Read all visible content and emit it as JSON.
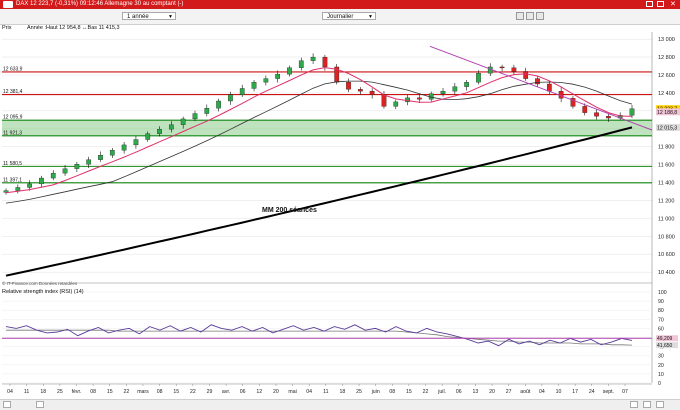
{
  "titlebar": {
    "title": "DAX  12 223,7 (-0,31%)  09:12:46 Allemagne 30 au comptant (-)",
    "color": "#d21a1a"
  },
  "toolbar": {
    "period": "1 année",
    "interval": "Journalier"
  },
  "chart_header": {
    "label": "Prix",
    "stats": "Année :Haut 12 954,8 ↔Bas 11 415,3"
  },
  "copyright": "© IT-Finance.com Données retardées",
  "rsi_header": "Relative strength index (RSI) (14)",
  "chart_data": [
    {
      "type": "candlestick",
      "xlabel": "",
      "ylabel": "",
      "x_ticks": [
        "04",
        "11",
        "18",
        "25",
        "févr.",
        "08",
        "15",
        "22",
        "mars",
        "08",
        "15",
        "22",
        "29",
        "avr.",
        "06",
        "12",
        "20",
        "mai",
        "04",
        "11",
        "18",
        "25",
        "juin",
        "08",
        "15",
        "22",
        "juil.",
        "06",
        "13",
        "20",
        "27",
        "août",
        "04",
        "10",
        "17",
        "24",
        "sept.",
        "07"
      ],
      "y_ticks": [
        10400,
        10600,
        10800,
        11000,
        11200,
        11400,
        11600,
        11800,
        12000,
        12200,
        12400,
        12600,
        12800,
        13000
      ],
      "ylim": [
        10290,
        13080
      ],
      "close_approx": [
        11310,
        11345,
        11385,
        11450,
        11505,
        11555,
        11605,
        11655,
        11705,
        11760,
        11820,
        11880,
        11945,
        11995,
        12045,
        12110,
        12170,
        12230,
        12310,
        12380,
        12450,
        12520,
        12560,
        12610,
        12680,
        12760,
        12800,
        12690,
        12520,
        12440,
        12420,
        12380,
        12250,
        12300,
        12345,
        12330,
        12390,
        12420,
        12470,
        12520,
        12620,
        12690,
        12680,
        12640,
        12560,
        12500,
        12420,
        12340,
        12250,
        12180,
        12140,
        12120,
        12150,
        12223.7
      ],
      "horizontal_levels": [
        {
          "value": 12633.9,
          "label": "12 633,9",
          "color": "#cc1111"
        },
        {
          "value": 12381.4,
          "label": "12 381,4",
          "color": "#cc1111"
        },
        {
          "value": 12095.9,
          "label": "12 095,9",
          "color": "#118811"
        },
        {
          "value": 11921.3,
          "label": "11 921,3",
          "color": "#118811"
        },
        {
          "value": 11580.5,
          "label": "11 580,5",
          "color": "#118811"
        },
        {
          "value": 11397.1,
          "label": "11 397,1",
          "color": "#118811"
        }
      ],
      "support_zone": [
        11921.3,
        12095.9
      ],
      "price_tags": [
        {
          "value": 12223.7,
          "label": "12 223,7",
          "bg": "#ffd200"
        },
        {
          "value": 12188.8,
          "label": "12 188,8",
          "bg": "#f2c4d8"
        },
        {
          "value": 12015.3,
          "label": "12 015,3",
          "bg": "#dddddd"
        }
      ],
      "moving_averages": {
        "mm200": {
          "label": "MM 200 séances",
          "start": 10360,
          "end": 12015,
          "color": "#000000"
        },
        "mm50": {
          "color": "#333333"
        },
        "mm20": {
          "color": "#e0306a"
        }
      },
      "trendline": {
        "from": 12920,
        "to": 12120,
        "color": "#b03fb0"
      }
    },
    {
      "type": "line",
      "name": "Relative strength index (RSI) (14)",
      "y_ticks": [
        0,
        10,
        20,
        30,
        40,
        50,
        60,
        70,
        80,
        90,
        100
      ],
      "ylim": [
        0,
        100
      ],
      "rsi_values": [
        62,
        60,
        63,
        58,
        55,
        56,
        59,
        52,
        57,
        61,
        55,
        58,
        60,
        54,
        62,
        58,
        63,
        57,
        61,
        56,
        64,
        60,
        58,
        62,
        57,
        61,
        55,
        59,
        63,
        58,
        61,
        57,
        62,
        59,
        64,
        58,
        60,
        56,
        62,
        57,
        55,
        60,
        56,
        54,
        51,
        48,
        44,
        46,
        41,
        48,
        43,
        46,
        42,
        47,
        44,
        49,
        45,
        48,
        42,
        45,
        49,
        46.8
      ],
      "signal_values": [
        58,
        58,
        58,
        58,
        58,
        58,
        58,
        58,
        58,
        58,
        58,
        57,
        57,
        57,
        57,
        57,
        57,
        57,
        57,
        57,
        57,
        57,
        57,
        57,
        57,
        57,
        57,
        57,
        57,
        57,
        57,
        57,
        57,
        57,
        57,
        57,
        57,
        57,
        57,
        56,
        55,
        54,
        53,
        51,
        50,
        49,
        48,
        47,
        46,
        46,
        45,
        45,
        44,
        44,
        44,
        44,
        43,
        43,
        43,
        42,
        42,
        41.6
      ],
      "level": {
        "value": 49.2,
        "label": "49,209",
        "color": "#b03fb0"
      },
      "tags": [
        {
          "value": 49.2,
          "label": "49,209",
          "bg": "#f2c4d8"
        },
        {
          "value": 41.6,
          "label": "41,650",
          "bg": "#dddddd"
        }
      ]
    }
  ]
}
